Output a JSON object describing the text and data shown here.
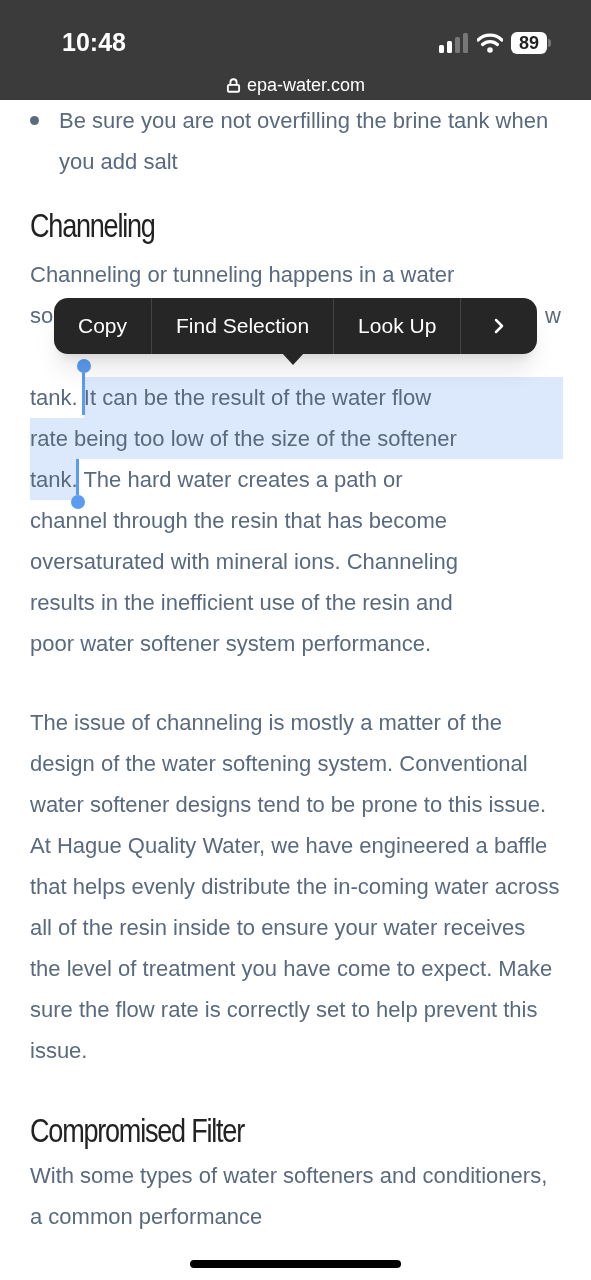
{
  "status_bar": {
    "time": "10:48",
    "battery": "89"
  },
  "address_bar": {
    "domain": "epa-water.com"
  },
  "article": [
    {
      "kind": "bullet",
      "text": "Be sure you are not overfilling the brine tank when you add salt"
    },
    {
      "kind": "heading",
      "text": "Channeling"
    },
    {
      "kind": "lines",
      "lines": [
        {
          "segments": [
            {
              "text": "Channeling or tunneling happens in a water",
              "selected": false
            }
          ]
        },
        {
          "kind": "covered",
          "segments": [
            {
              "text": "so",
              "selected": false
            },
            {
              "text": "w",
              "selected": false
            }
          ]
        },
        {
          "kind": "hidden"
        },
        {
          "segments": [
            {
              "text": "tank. ",
              "selected": false
            },
            {
              "text": "It can be the result of the water flow",
              "selected": true
            }
          ]
        },
        {
          "segments": [
            {
              "text": "rate being too low of the size of the softener",
              "selected": true
            }
          ]
        },
        {
          "segments": [
            {
              "text": "tank.",
              "selected": true
            },
            {
              "text": " The hard water creates a path or",
              "selected": false
            }
          ]
        },
        {
          "segments": [
            {
              "text": "channel through the resin that has become",
              "selected": false
            }
          ]
        },
        {
          "segments": [
            {
              "text": "oversaturated with mineral ions. Channeling",
              "selected": false
            }
          ]
        },
        {
          "segments": [
            {
              "text": "results in the inefficient use of the resin and",
              "selected": false
            }
          ]
        },
        {
          "segments": [
            {
              "text": "poor water softener system performance.",
              "selected": false
            }
          ]
        }
      ]
    },
    {
      "kind": "paragraph",
      "text": "The issue of channeling is mostly a matter of the design of the water softening system. Conventional water softener designs tend to be prone to this issue. At Hague Quality Water, we have engineered a baffle that helps evenly distribute the in-coming water across all of the resin inside to ensure your water receives the level of treatment you have come to expect. Make sure the flow rate is correctly set to help prevent this issue."
    },
    {
      "kind": "heading",
      "text": "Compromised Filter"
    },
    {
      "kind": "paragraph",
      "text": "With some types of water softeners and conditioners, a common performance"
    }
  ],
  "context_menu": {
    "items": [
      "Copy",
      "Find Selection",
      "Look Up"
    ]
  }
}
